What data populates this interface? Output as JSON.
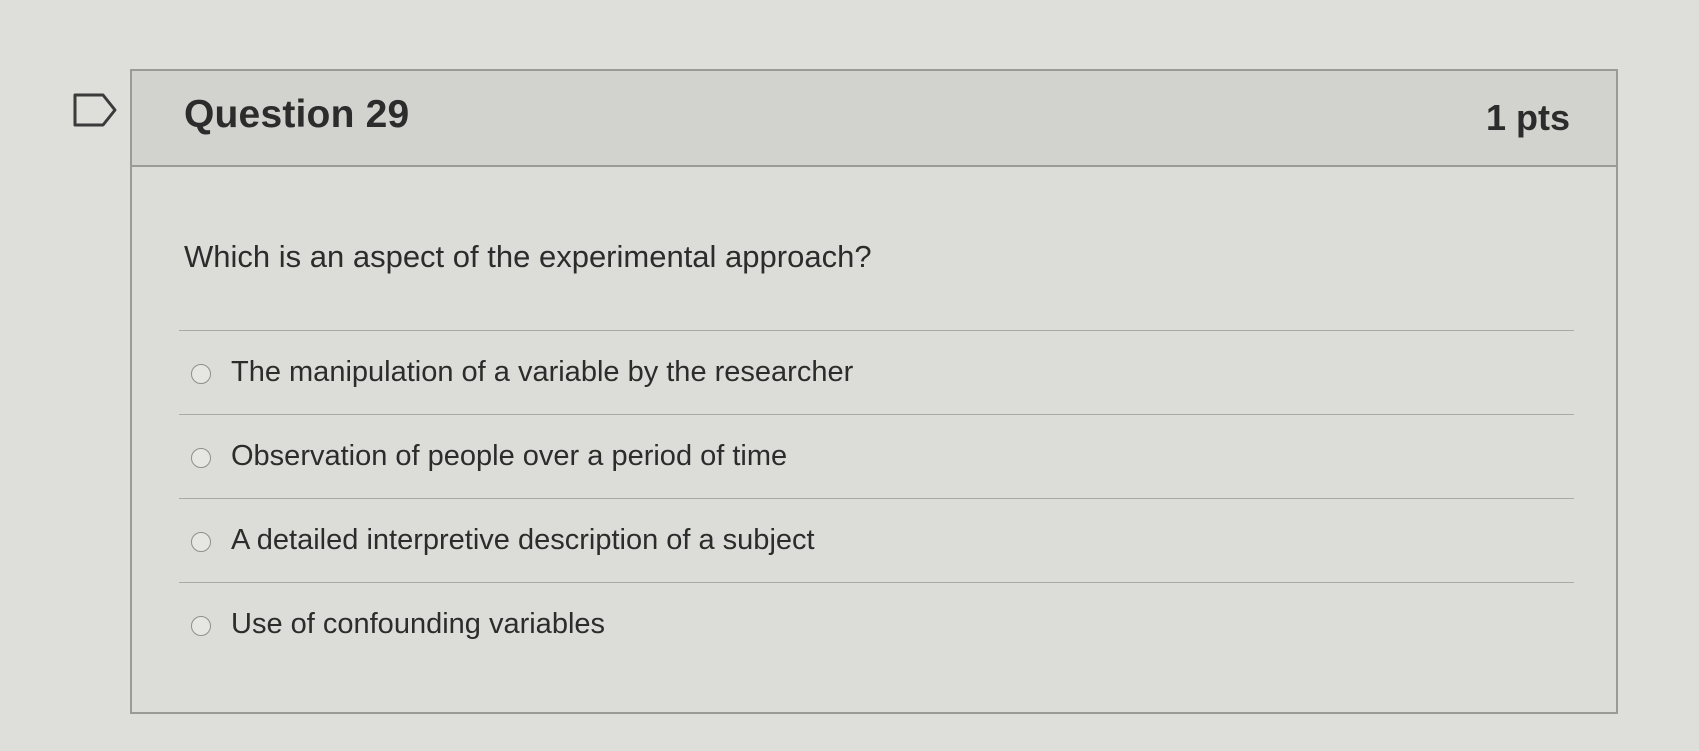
{
  "question": {
    "title": "Question 29",
    "points": "1 pts",
    "text": "Which is an aspect of the experimental approach?",
    "flag_icon": "flag-outline-icon"
  },
  "answers": [
    {
      "label": "The manipulation of a variable by the researcher",
      "selected": false
    },
    {
      "label": "Observation of people over a period of time",
      "selected": false
    },
    {
      "label": "A detailed interpretive description of a subject",
      "selected": false
    },
    {
      "label": "Use of confounding variables",
      "selected": false
    }
  ],
  "colors": {
    "page_background": "#dedfdb",
    "header_background": "#d2d3cf",
    "border": "#9a9b98",
    "text": "#2b2c2b"
  }
}
